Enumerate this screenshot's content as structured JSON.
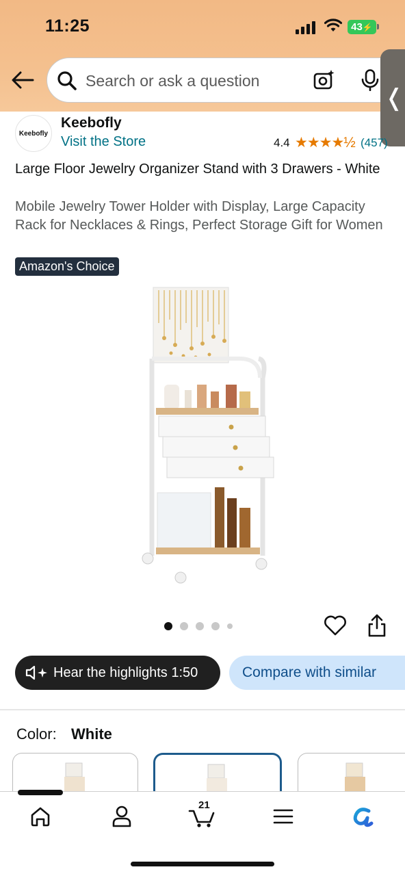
{
  "status_bar": {
    "time": "11:25",
    "battery": "43"
  },
  "search": {
    "placeholder": "Search or ask a question"
  },
  "brand": {
    "logo_text": "Keebofly",
    "name": "Keebofly",
    "visit_store": "Visit the Store",
    "rating": "4.4",
    "stars": "★★★★½",
    "rating_count": "(457)"
  },
  "product": {
    "title_bold": "Large Floor Jewelry Organizer Stand with 3 Drawers - White",
    "title_rest": "Mobile Jewelry Tower Holder with Display, Large Capacity Rack for Necklaces & Rings, Perfect Storage Gift for Women",
    "badge": "Amazon's Choice",
    "image_count": 5,
    "active_image": 1
  },
  "actions": {
    "hear_highlights": "Hear the highlights 1:50",
    "compare": "Compare with similar"
  },
  "color": {
    "label": "Color:",
    "value": "White",
    "swatch_count": 3,
    "selected_swatch": 2
  },
  "bottom_nav": {
    "cart_count": "21",
    "items": [
      "home",
      "account",
      "cart",
      "menu",
      "rufus"
    ]
  },
  "colors": {
    "header_bg": "#f4c08e",
    "link": "#007185",
    "star": "#e67a00",
    "badge_bg": "#232f3e",
    "compare_bg": "#cfe5fb",
    "selected_border": "#1d5b8c"
  }
}
